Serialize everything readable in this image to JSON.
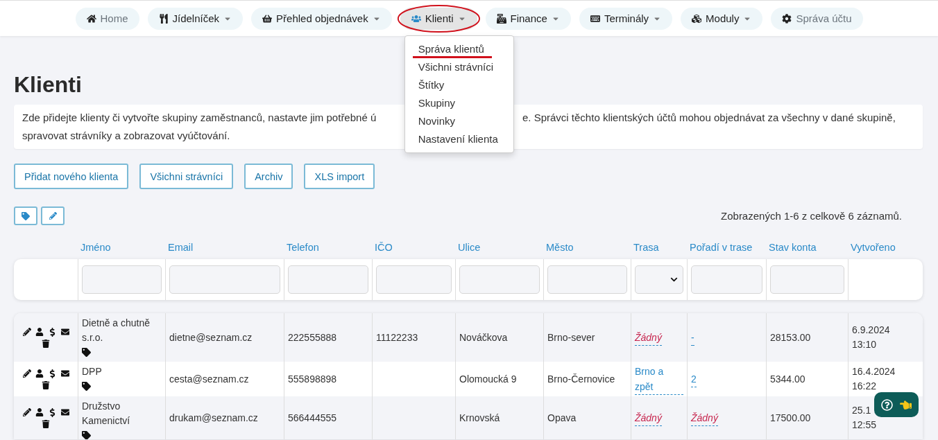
{
  "nav": [
    {
      "label": "Home",
      "kind": "link",
      "selected": false
    },
    {
      "label": "Jídelníček",
      "kind": "dropdown",
      "selected": false
    },
    {
      "label": "Přehled objednávek",
      "kind": "dropdown",
      "selected": false
    },
    {
      "label": "Klienti",
      "kind": "dropdown",
      "selected": true
    },
    {
      "label": "Finance",
      "kind": "dropdown",
      "selected": false
    },
    {
      "label": "Terminály",
      "kind": "dropdown",
      "selected": false
    },
    {
      "label": "Moduly",
      "kind": "dropdown",
      "selected": false
    },
    {
      "label": "Správa účtu",
      "kind": "link",
      "selected": false
    }
  ],
  "menu": [
    "Správa klientů",
    "Všichni strávníci",
    "Štítky",
    "Skupiny",
    "Novinky",
    "Nastavení klienta"
  ],
  "title": "Klienti",
  "description": {
    "before_menu": "Zde přidejte klienty či vytvořte skupiny zaměstnanců, nastavte jim potřebné ú",
    "after_menu": "e. Správci těchto klientských účtů mohou objednávat za všechny v dané skupině,",
    "second_line": "spravovat strávníky a zobrazovat vyúčtování."
  },
  "buttons": [
    "Přidat nového klienta",
    "Všichni strávníci",
    "Archiv",
    "XLS import"
  ],
  "record_count": "Zobrazených 1-6 z celkově 6 záznamů.",
  "table": {
    "columns": [
      "Jméno",
      "Email",
      "Telefon",
      "IČO",
      "Ulice",
      "Město",
      "Trasa",
      "Pořadí v trase",
      "Stav konta",
      "Vytvořeno"
    ],
    "filters": [
      {
        "kind": "text"
      },
      {
        "kind": "text"
      },
      {
        "kind": "text"
      },
      {
        "kind": "text"
      },
      {
        "kind": "text"
      },
      {
        "kind": "text"
      },
      {
        "kind": "select"
      },
      {
        "kind": "text"
      },
      {
        "kind": "text"
      },
      {
        "kind": "none"
      }
    ],
    "rows": [
      {
        "name": "Dietně a chutně s.r.o.",
        "email": "dietne@seznam.cz",
        "phone": "222555888",
        "ico": "11122233",
        "street": "Nováčkova",
        "city": "Brno-sever",
        "route": {
          "text": "Žádný",
          "empty": true
        },
        "order": {
          "text": "-",
          "empty": false
        },
        "balance": "28153.00",
        "created": [
          "6.9.2024",
          "13:10"
        ]
      },
      {
        "name": "DPP",
        "email": "cesta@seznam.cz",
        "phone": "555898898",
        "ico": "",
        "street": "Olomoucká 9",
        "city": "Brno-Černovice",
        "route": {
          "text": "Brno a zpět",
          "empty": false
        },
        "order": {
          "text": "2",
          "empty": false
        },
        "balance": "5344.00",
        "created": [
          "16.4.2024",
          "16:22"
        ]
      },
      {
        "name": "Družstvo Kamenictví",
        "email": "drukam@seznam.cz",
        "phone": "566444555",
        "ico": "",
        "street": "Krnovská",
        "city": "Opava",
        "route": {
          "text": "Žádný",
          "empty": true
        },
        "order": {
          "text": "Žádný",
          "empty": true
        },
        "balance": "17500.00",
        "created": [
          "25.1",
          "12:55"
        ]
      }
    ]
  }
}
